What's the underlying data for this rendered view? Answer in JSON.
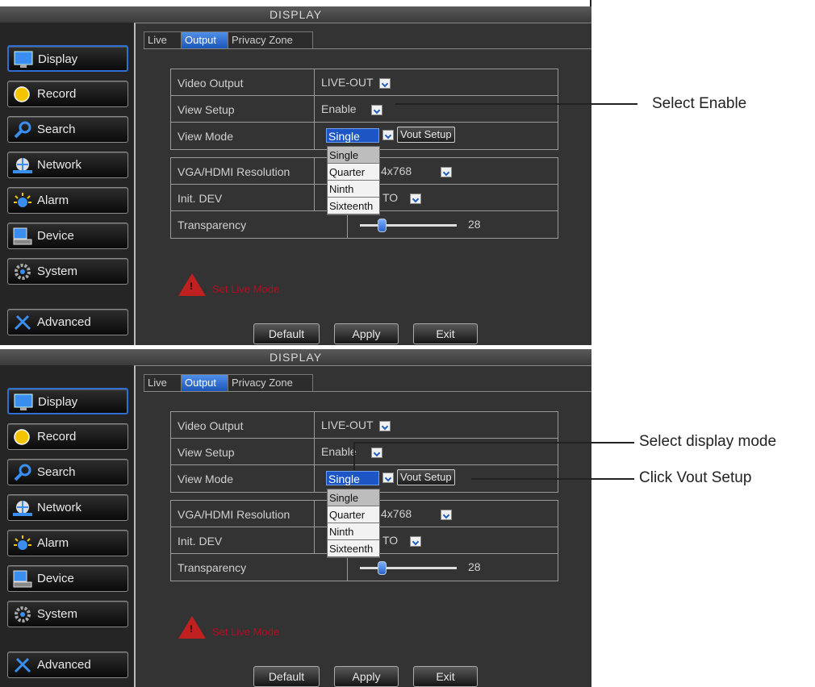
{
  "window_title": "DISPLAY",
  "sidebar": {
    "items": [
      {
        "label": "Display",
        "icon": "monitor-icon"
      },
      {
        "label": "Record",
        "icon": "record-icon"
      },
      {
        "label": "Search",
        "icon": "search-icon"
      },
      {
        "label": "Network",
        "icon": "network-icon"
      },
      {
        "label": "Alarm",
        "icon": "alarm-icon"
      },
      {
        "label": "Device",
        "icon": "device-icon"
      },
      {
        "label": "System",
        "icon": "system-icon"
      },
      {
        "label": "Advanced",
        "icon": "advanced-icon"
      }
    ]
  },
  "tabs": [
    "Live",
    "Output",
    "Privacy Zone"
  ],
  "active_tab": "Output",
  "settings": {
    "video_output_label": "Video Output",
    "video_output_value": "LIVE-OUT",
    "view_setup_label": "View Setup",
    "view_setup_value": "Enable",
    "view_mode_label": "View Mode",
    "view_mode_value": "Single",
    "vout_setup_button": "Vout Setup",
    "vga_label": "VGA/HDMI Resolution",
    "vga_value_visible": "4x768",
    "init_dev_label": "Init. DEV",
    "init_dev_value_visible": "TO",
    "transparency_label": "Transparency",
    "transparency_value": "28"
  },
  "view_mode_options": [
    "Single",
    "Quarter",
    "Ninth",
    "Sixteenth"
  ],
  "warning_text": "Set Live Mode",
  "buttons": {
    "default": "Default",
    "apply": "Apply",
    "exit": "Exit"
  },
  "callouts": {
    "select_enable": "Select Enable",
    "select_display_mode": "Select display mode",
    "click_vout_setup": "Click Vout Setup"
  },
  "colors": {
    "accent_blue": "#1d56c4",
    "warning_red": "#c02020"
  }
}
